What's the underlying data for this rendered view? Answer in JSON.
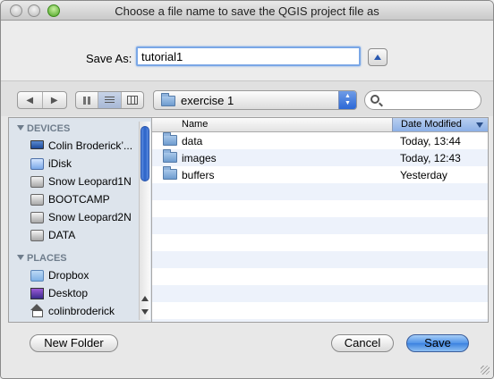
{
  "window": {
    "title": "Choose a file name to save the QGIS project file as"
  },
  "save_as": {
    "label": "Save As:",
    "value": "tutorial1"
  },
  "toolbar": {
    "location": "exercise 1",
    "search_placeholder": ""
  },
  "sidebar": {
    "devices_header": "DEVICES",
    "devices": [
      {
        "label": "Colin Broderick’...",
        "icon": "computer-icon"
      },
      {
        "label": "iDisk",
        "icon": "idisk-icon"
      },
      {
        "label": "Snow Leopard1N",
        "icon": "drive-icon"
      },
      {
        "label": "BOOTCAMP",
        "icon": "drive-icon"
      },
      {
        "label": "Snow Leopard2N",
        "icon": "drive-icon"
      },
      {
        "label": "DATA",
        "icon": "drive-icon"
      }
    ],
    "places_header": "PLACES",
    "places": [
      {
        "label": "Dropbox",
        "icon": "dropbox-folder-icon"
      },
      {
        "label": "Desktop",
        "icon": "desktop-icon"
      },
      {
        "label": "colinbroderick",
        "icon": "home-icon"
      }
    ]
  },
  "file_list": {
    "col_name": "Name",
    "col_date": "Date Modified",
    "rows": [
      {
        "name": "data",
        "date": "Today, 13:44"
      },
      {
        "name": "images",
        "date": "Today, 12:43"
      },
      {
        "name": "buffers",
        "date": "Yesterday"
      }
    ]
  },
  "buttons": {
    "new_folder": "New Folder",
    "cancel": "Cancel",
    "save": "Save"
  },
  "colors": {
    "accent": "#3b82df",
    "sidebar_bg": "#dde4ec",
    "sort_column": "#a8c3ec"
  }
}
